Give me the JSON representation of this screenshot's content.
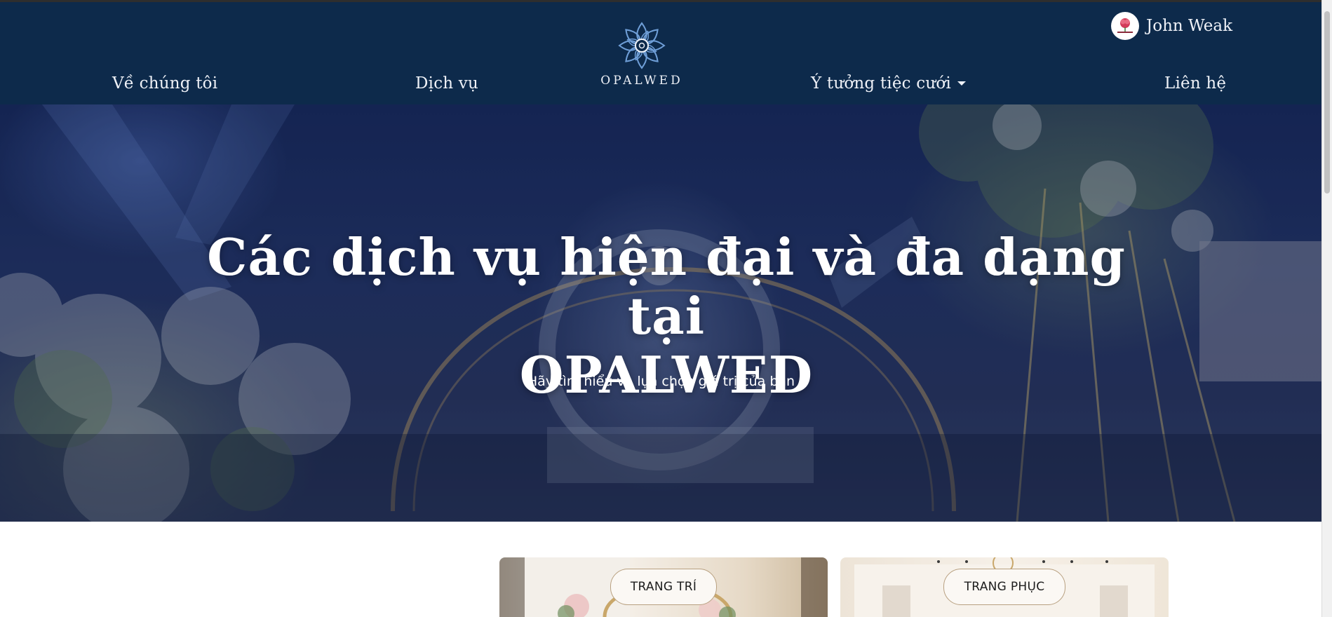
{
  "header": {
    "nav": [
      {
        "label": "Về chúng tôi"
      },
      {
        "label": "Dịch vụ"
      },
      {
        "label": "Ý tưởng tiệc cưới",
        "has_dropdown": true
      },
      {
        "label": "Liên hệ"
      }
    ],
    "logo_text": "OPALWED",
    "user": {
      "name": "John Weak",
      "avatar_icon": "rose-logo-avatar"
    }
  },
  "hero": {
    "title_line1": "Các dịch vụ hiện đại và đa dạng tại",
    "title_line2": "OPALWED",
    "subtitle": "Hãy tìm hiểu và lựa chọn giá trị của bạn"
  },
  "cards": [
    {
      "label": "TRANG TRÍ"
    },
    {
      "label": "TRANG PHỤC"
    }
  ],
  "colors": {
    "header_bg": "#0d2a4b",
    "nav_text": "#eef1f7",
    "logo_accent": "#6f9fd8",
    "card_label_border": "#b8a080"
  }
}
